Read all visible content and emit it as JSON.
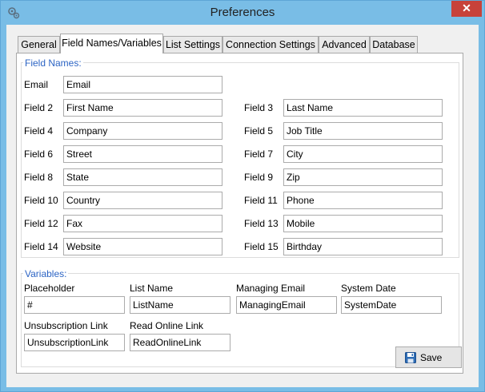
{
  "window": {
    "title": "Preferences",
    "close_glyph": "✕"
  },
  "tabs": [
    {
      "label": "General"
    },
    {
      "label": "Field Names/Variables"
    },
    {
      "label": "List Settings"
    },
    {
      "label": "Connection Settings"
    },
    {
      "label": "Advanced"
    },
    {
      "label": "Database"
    }
  ],
  "active_tab": "Field Names/Variables",
  "field_names": {
    "title": "Field Names:",
    "fields": [
      {
        "label": "Email",
        "value": "Email"
      },
      {
        "label": "Field 2",
        "value": "First Name"
      },
      {
        "label": "Field 3",
        "value": "Last Name"
      },
      {
        "label": "Field 4",
        "value": "Company"
      },
      {
        "label": "Field 5",
        "value": "Job Title"
      },
      {
        "label": "Field 6",
        "value": "Street"
      },
      {
        "label": "Field 7",
        "value": "City"
      },
      {
        "label": "Field 8",
        "value": "State"
      },
      {
        "label": "Field 9",
        "value": "Zip"
      },
      {
        "label": "Field 10",
        "value": "Country"
      },
      {
        "label": "Field 11",
        "value": "Phone"
      },
      {
        "label": "Field 12",
        "value": "Fax"
      },
      {
        "label": "Field 13",
        "value": "Mobile"
      },
      {
        "label": "Field 14",
        "value": "Website"
      },
      {
        "label": "Field 15",
        "value": "Birthday"
      }
    ]
  },
  "variables": {
    "title": "Variables:",
    "items": [
      {
        "label": "Placeholder",
        "value": "#"
      },
      {
        "label": "List Name",
        "value": "ListName"
      },
      {
        "label": "Managing Email",
        "value": "ManagingEmail"
      },
      {
        "label": "System Date",
        "value": "SystemDate"
      },
      {
        "label": "Unsubscription Link",
        "value": "UnsubscriptionLink"
      },
      {
        "label": "Read Online Link",
        "value": "ReadOnlineLink"
      }
    ]
  },
  "buttons": {
    "save_label": "Save",
    "save_icon": "floppy-disk-icon"
  },
  "colors": {
    "window_frame": "#79bde6",
    "group_title": "#2c64c4",
    "close_button": "#c7423a"
  }
}
